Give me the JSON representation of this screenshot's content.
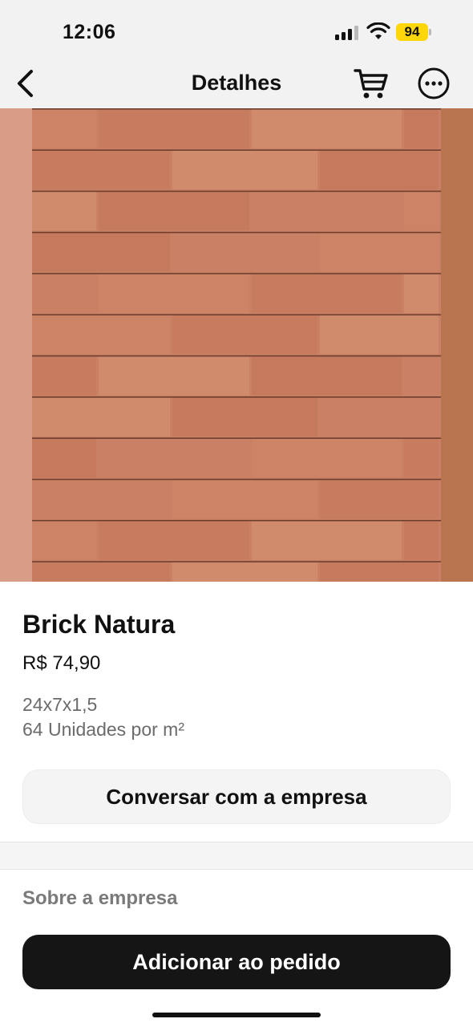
{
  "status_bar": {
    "time": "12:06",
    "battery_level": "94",
    "battery_color": "#ffd60a",
    "icons": [
      "cellular-signal-icon",
      "wifi-icon",
      "battery-icon"
    ]
  },
  "nav": {
    "title": "Detalhes",
    "icons": [
      "chevron-left-icon",
      "cart-icon",
      "more-options-icon"
    ]
  },
  "product": {
    "name": "Brick Natura",
    "price": "R$ 74,90",
    "dimensions": "24x7x1,5",
    "units": "64 Unidades por m²",
    "image_colors": {
      "brick": "#c98064",
      "mortar": "#6e3f2e",
      "side_left": "#d89d86",
      "side_right": "#b8734f"
    }
  },
  "actions": {
    "chat_label": "Conversar com a empresa",
    "about_label": "Sobre a empresa",
    "add_label": "Adicionar ao pedido"
  }
}
